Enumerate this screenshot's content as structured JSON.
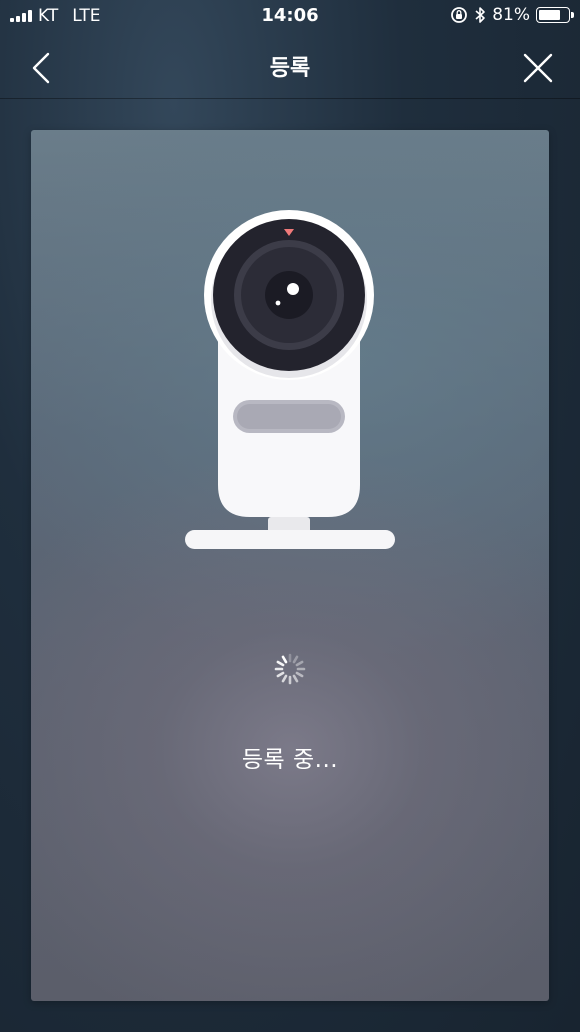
{
  "status_bar": {
    "carrier": "KT",
    "network": "LTE",
    "time": "14:06",
    "battery_percent": "81%",
    "battery_level": 0.81,
    "icons": [
      "signal-icon",
      "rotation-lock-icon",
      "bluetooth-icon",
      "battery-icon"
    ]
  },
  "nav": {
    "title": "등록",
    "back_icon": "chevron-left-icon",
    "close_icon": "close-icon"
  },
  "content": {
    "illustration": "camera-illustration",
    "spinner": "loading-spinner-icon",
    "message": "등록 중..."
  },
  "colors": {
    "background": "#1f2e3d",
    "card": "#5e6b78",
    "text": "#ffffff",
    "camera_body": "#ffffff",
    "lens": "#23232d",
    "indicator": "#f07a7a"
  }
}
